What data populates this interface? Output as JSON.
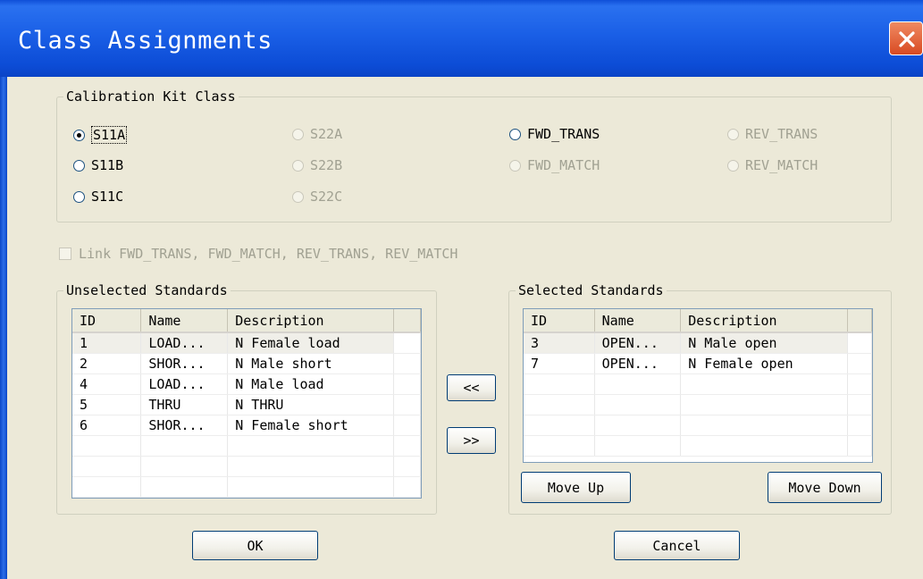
{
  "window": {
    "title": "Class Assignments"
  },
  "kit_group": {
    "legend": "Calibration Kit Class",
    "radios": [
      {
        "label": "S11A",
        "selected": true,
        "enabled": true
      },
      {
        "label": "S11B",
        "selected": false,
        "enabled": true
      },
      {
        "label": "S11C",
        "selected": false,
        "enabled": true
      },
      {
        "label": "S22A",
        "selected": false,
        "enabled": false
      },
      {
        "label": "S22B",
        "selected": false,
        "enabled": false
      },
      {
        "label": "S22C",
        "selected": false,
        "enabled": false
      },
      {
        "label": "FWD_TRANS",
        "selected": false,
        "enabled": true
      },
      {
        "label": "FWD_MATCH",
        "selected": false,
        "enabled": false
      },
      {
        "label": "REV_TRANS",
        "selected": false,
        "enabled": false
      },
      {
        "label": "REV_MATCH",
        "selected": false,
        "enabled": false
      }
    ]
  },
  "link_checkbox": {
    "label": "Link FWD_TRANS, FWD_MATCH, REV_TRANS, REV_MATCH",
    "checked": false,
    "enabled": false
  },
  "unselected": {
    "legend": "Unselected Standards",
    "columns": [
      "ID",
      "Name",
      "Description"
    ],
    "rows": [
      [
        "1",
        "LOAD...",
        "N Female load"
      ],
      [
        "2",
        "SHOR...",
        "N Male short"
      ],
      [
        "4",
        "LOAD...",
        "N Male load"
      ],
      [
        "5",
        "THRU",
        "N THRU"
      ],
      [
        "6",
        "SHOR...",
        "N Female short"
      ]
    ]
  },
  "selected": {
    "legend": "Selected Standards",
    "columns": [
      "ID",
      "Name",
      "Description"
    ],
    "rows": [
      [
        "3",
        "OPEN...",
        "N Male open"
      ],
      [
        "7",
        "OPEN...",
        "N Female open"
      ]
    ]
  },
  "buttons": {
    "move_left": "<<",
    "move_right": ">>",
    "move_up": "Move Up",
    "move_down": "Move Down",
    "ok": "OK",
    "cancel": "Cancel"
  },
  "icons": {
    "close": "close-icon"
  }
}
